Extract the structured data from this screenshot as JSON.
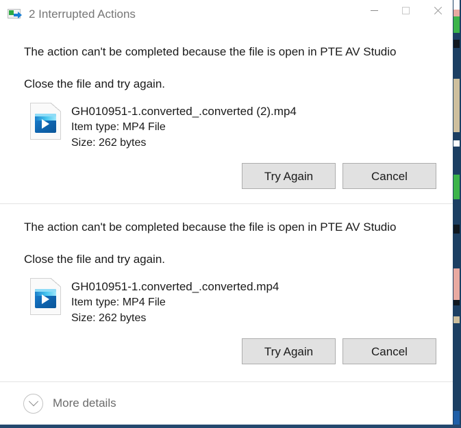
{
  "window": {
    "title": "2 Interrupted Actions",
    "app_icon": "file-move-icon",
    "controls": {
      "minimize": "minimize-icon",
      "maximize": "maximize-icon",
      "close": "close-icon"
    }
  },
  "conflicts": [
    {
      "headline": "The action can't be completed because the file is open in PTE AV Studio",
      "subline": "Close the file and try again.",
      "file": {
        "name": "GH010951-1.converted_.converted (2).mp4",
        "item_type": "Item type: MP4 File",
        "size": "Size: 262 bytes",
        "icon": "mp4-video-file-icon"
      },
      "buttons": {
        "primary": "Try Again",
        "secondary": "Cancel"
      }
    },
    {
      "headline": "The action can't be completed because the file is open in PTE AV Studio",
      "subline": "Close the file and try again.",
      "file": {
        "name": "GH010951-1.converted_.converted.mp4",
        "item_type": "Item type: MP4 File",
        "size": "Size: 262 bytes",
        "icon": "mp4-video-file-icon"
      },
      "buttons": {
        "primary": "Try Again",
        "secondary": "Cancel"
      }
    }
  ],
  "footer": {
    "more_details_label": "More details",
    "more_details_icon": "chevron-down-circle-icon"
  },
  "colors": {
    "dialog_background": "#ffffff",
    "title_text": "#767676",
    "body_text": "#1a1a1a",
    "button_face": "#e1e1e1",
    "button_border": "#adadad",
    "divider": "#e3e3e3",
    "footer_text": "#6b6b6b",
    "background_window": "#1c3f63"
  }
}
